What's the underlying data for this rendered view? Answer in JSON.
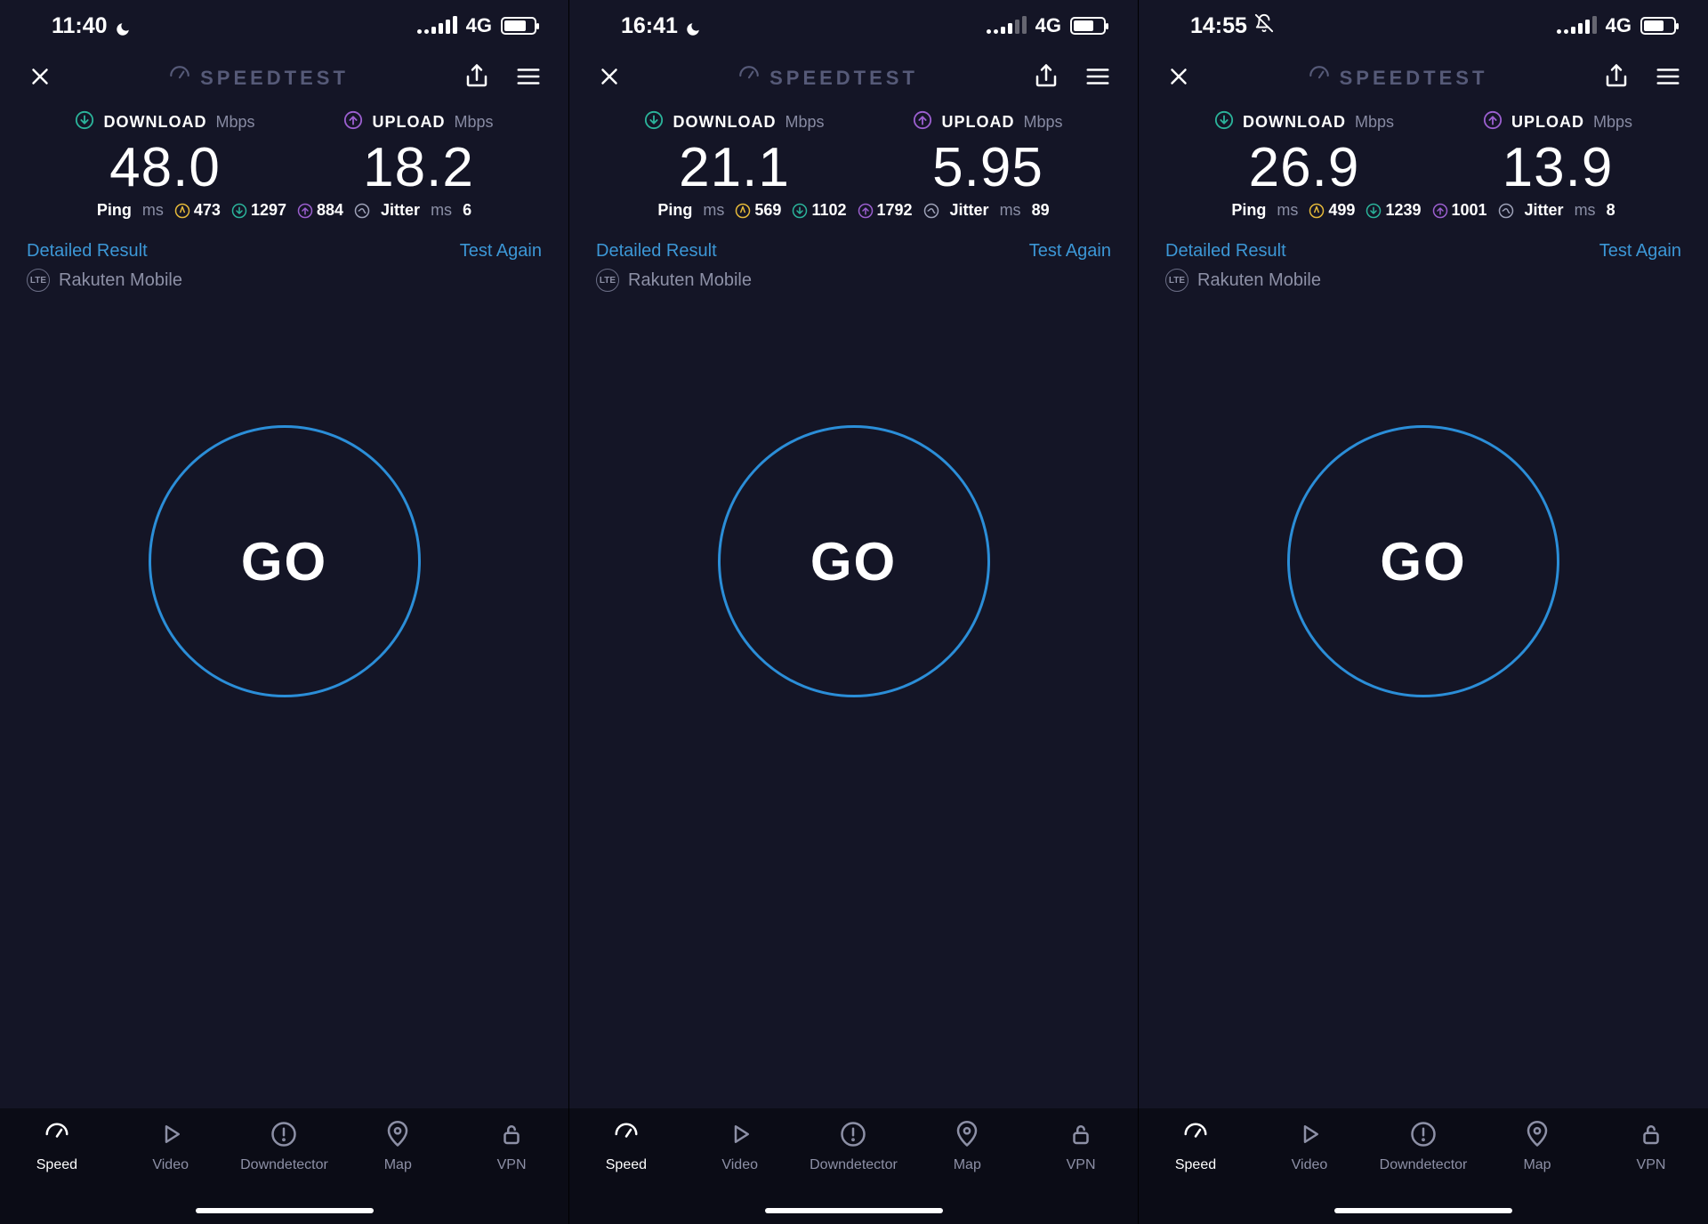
{
  "app_title": "SPEEDTEST",
  "labels": {
    "download": "DOWNLOAD",
    "upload": "UPLOAD",
    "unit_mbps": "Mbps",
    "ping": "Ping",
    "ms": "ms",
    "jitter": "Jitter",
    "detailed": "Detailed Result",
    "test_again": "Test Again",
    "go": "GO",
    "lte_badge": "LTE"
  },
  "tabs": [
    {
      "label": "Speed"
    },
    {
      "label": "Video"
    },
    {
      "label": "Downdetector"
    },
    {
      "label": "Map"
    },
    {
      "label": "VPN"
    }
  ],
  "screens": [
    {
      "status": {
        "time": "11:40",
        "icon": "moon",
        "network": "4G",
        "signal_bars": 4,
        "signal_max": 4,
        "battery_pct": 75
      },
      "download": "48.0",
      "upload": "18.2",
      "ping": {
        "idle": "473",
        "down": "1297",
        "up": "884"
      },
      "jitter": "6",
      "carrier": "Rakuten Mobile"
    },
    {
      "status": {
        "time": "16:41",
        "icon": "moon",
        "network": "4G",
        "signal_bars": 2,
        "signal_max": 4,
        "battery_pct": 70
      },
      "download": "21.1",
      "upload": "5.95",
      "ping": {
        "idle": "569",
        "down": "1102",
        "up": "1792"
      },
      "jitter": "89",
      "carrier": "Rakuten Mobile"
    },
    {
      "status": {
        "time": "14:55",
        "icon": "bell-off",
        "network": "4G",
        "signal_bars": 3,
        "signal_max": 4,
        "battery_pct": 70
      },
      "download": "26.9",
      "upload": "13.9",
      "ping": {
        "idle": "499",
        "down": "1239",
        "up": "1001"
      },
      "jitter": "8",
      "carrier": "Rakuten Mobile"
    }
  ],
  "colors": {
    "idle": "#e5b93a",
    "down": "#2bb39a",
    "up": "#9b5fcf",
    "jitter": "#9ea2b8",
    "accent": "#2b8ed8"
  }
}
